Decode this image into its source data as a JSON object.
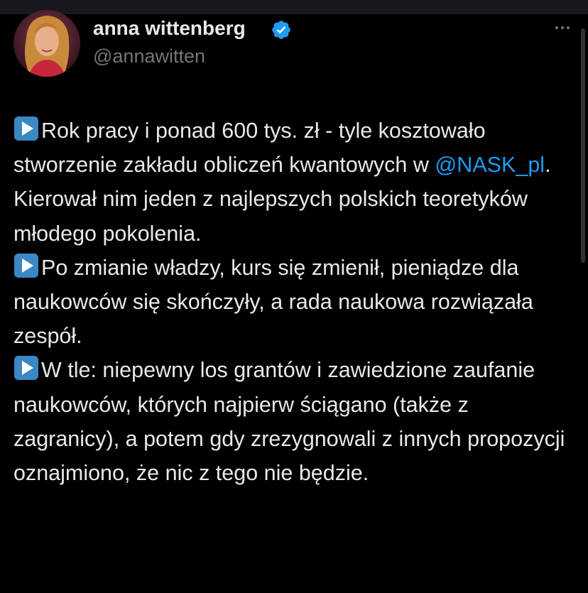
{
  "colors": {
    "background": "#000000",
    "text": "#e7e9ea",
    "muted": "#71767b",
    "link": "#1d9bf0",
    "verified": "#1d9bf0"
  },
  "author": {
    "display_name": "anna wittenberg",
    "handle": "@annawitten",
    "verified_icon": "verified-badge-icon"
  },
  "tweet": {
    "paragraphs": [
      {
        "icon": "play-button-emoji-icon",
        "text_before": "Rok pracy i ponad 600 tys. zł - tyle kosztowało stworzenie zakładu obliczeń kwantowych w ",
        "mention": "@NASK_pl",
        "text_after": ". Kierował nim jeden z najlepszych polskich teoretyków młodego pokolenia."
      },
      {
        "icon": "play-button-emoji-icon",
        "text": "Po zmianie władzy, kurs się zmienił, pieniądze dla naukowców się skończyły, a rada naukowa rozwiązała zespół."
      },
      {
        "icon": "play-button-emoji-icon",
        "text": "W tle: niepewny los grantów i zawiedzione zaufanie naukowców, których najpierw ściągano (także z zagranicy), a potem gdy zrezygnowali z innych propozycji oznajmiono, że nic z tego nie będzie."
      }
    ]
  }
}
